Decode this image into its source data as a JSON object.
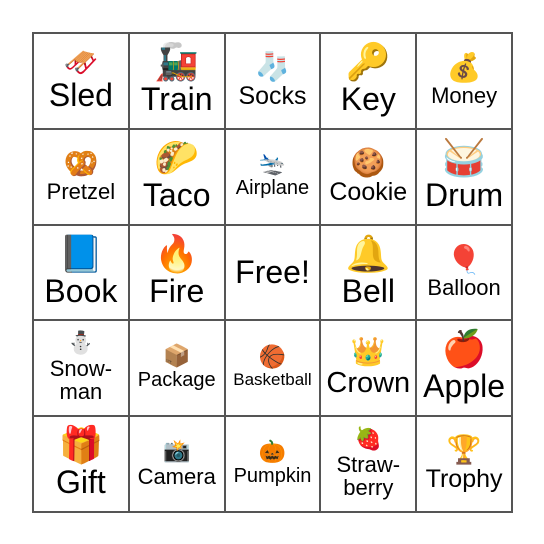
{
  "board": {
    "rows": [
      [
        {
          "label": "Sled",
          "icon": "sled-icon",
          "glyph": "🛷"
        },
        {
          "label": "Train",
          "icon": "train-icon",
          "glyph": "🚂"
        },
        {
          "label": "Socks",
          "icon": "socks-icon",
          "glyph": "🧦"
        },
        {
          "label": "Key",
          "icon": "key-icon",
          "glyph": "🔑"
        },
        {
          "label": "Money",
          "icon": "money-bag-icon",
          "glyph": "💰"
        }
      ],
      [
        {
          "label": "Pretzel",
          "icon": "pretzel-icon",
          "glyph": "🥨"
        },
        {
          "label": "Taco",
          "icon": "taco-icon",
          "glyph": "🌮"
        },
        {
          "label": "Airplane",
          "icon": "airplane-icon",
          "glyph": "🛬"
        },
        {
          "label": "Cookie",
          "icon": "cookie-icon",
          "glyph": "🍪"
        },
        {
          "label": "Drum",
          "icon": "drum-icon",
          "glyph": "🥁"
        }
      ],
      [
        {
          "label": "Book",
          "icon": "book-icon",
          "glyph": "📘"
        },
        {
          "label": "Fire",
          "icon": "fire-icon",
          "glyph": "🔥"
        },
        {
          "label": "Free!",
          "icon": "",
          "glyph": ""
        },
        {
          "label": "Bell",
          "icon": "bell-icon",
          "glyph": "🔔"
        },
        {
          "label": "Balloon",
          "icon": "balloon-icon",
          "glyph": "🎈"
        }
      ],
      [
        {
          "label": "Snow-\nman",
          "icon": "snowman-icon",
          "glyph": "⛄"
        },
        {
          "label": "Package",
          "icon": "package-icon",
          "glyph": "📦"
        },
        {
          "label": "Basketball",
          "icon": "basketball-icon",
          "glyph": "🏀"
        },
        {
          "label": "Crown",
          "icon": "crown-icon",
          "glyph": "👑"
        },
        {
          "label": "Apple",
          "icon": "apple-icon",
          "glyph": "🍎"
        }
      ],
      [
        {
          "label": "Gift",
          "icon": "gift-icon",
          "glyph": "🎁"
        },
        {
          "label": "Camera",
          "icon": "camera-icon",
          "glyph": "📸"
        },
        {
          "label": "Pumpkin",
          "icon": "pumpkin-icon",
          "glyph": "🎃"
        },
        {
          "label": "Straw-\nberry",
          "icon": "strawberry-icon",
          "glyph": "🍓"
        },
        {
          "label": "Trophy",
          "icon": "trophy-icon",
          "glyph": "🏆"
        }
      ]
    ]
  }
}
